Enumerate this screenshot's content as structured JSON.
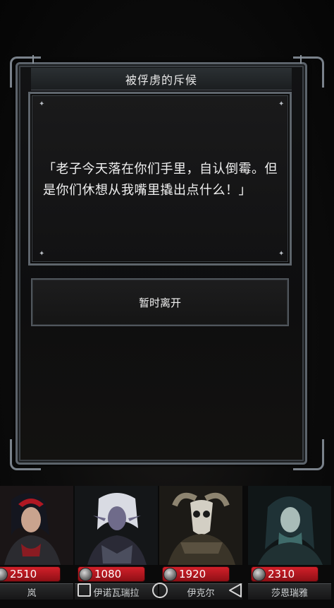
{
  "dialog": {
    "title": "被俘虏的斥候",
    "text": "「老子今天落在你们手里，自认倒霉。但是你们休想从我嘴里撬出点什么！」",
    "action_label": "暂时离开"
  },
  "heroes": [
    {
      "name": "岚",
      "hp": "2510"
    },
    {
      "name": "伊诺瓦瑞拉",
      "hp": "1080"
    },
    {
      "name": "伊克尔",
      "hp": "1920"
    },
    {
      "name": "莎恩瑞雅",
      "hp": "2310"
    }
  ],
  "nav": {
    "recent_icon": "square-icon",
    "home_icon": "circle-icon",
    "back_icon": "triangle-back-icon"
  },
  "colors": {
    "hp_bar": "#c81b24",
    "frame": "#5c636b",
    "text": "#f0f0f0"
  }
}
